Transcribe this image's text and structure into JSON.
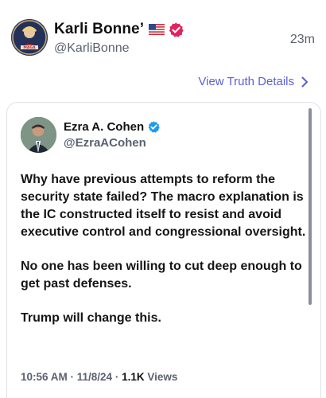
{
  "post": {
    "author_name": "Karli Bonne’",
    "author_handle": "@KarliBonne",
    "time": "23m",
    "flag_icon": "us-flag-icon",
    "verified_icon": "verified-badge-icon",
    "verified_color": "#e0245e"
  },
  "view_details": {
    "label": "View Truth Details",
    "color": "#5a5fd6"
  },
  "quote": {
    "author_name": "Ezra A. Cohen",
    "author_handle": "@EzraACohen",
    "verified_color": "#1d9bf0",
    "paragraphs": [
      "Why have previous attempts to reform the security state failed? The macro explanation is the IC constructed itself to resist and avoid executive control and congressional oversight.",
      "No one has been willing to cut deep enough to get past defenses.",
      "Trump will change this."
    ],
    "meta_time": "10:56 AM · 11/8/24 · ",
    "views_count": "1.1K",
    "views_label": " Views"
  }
}
